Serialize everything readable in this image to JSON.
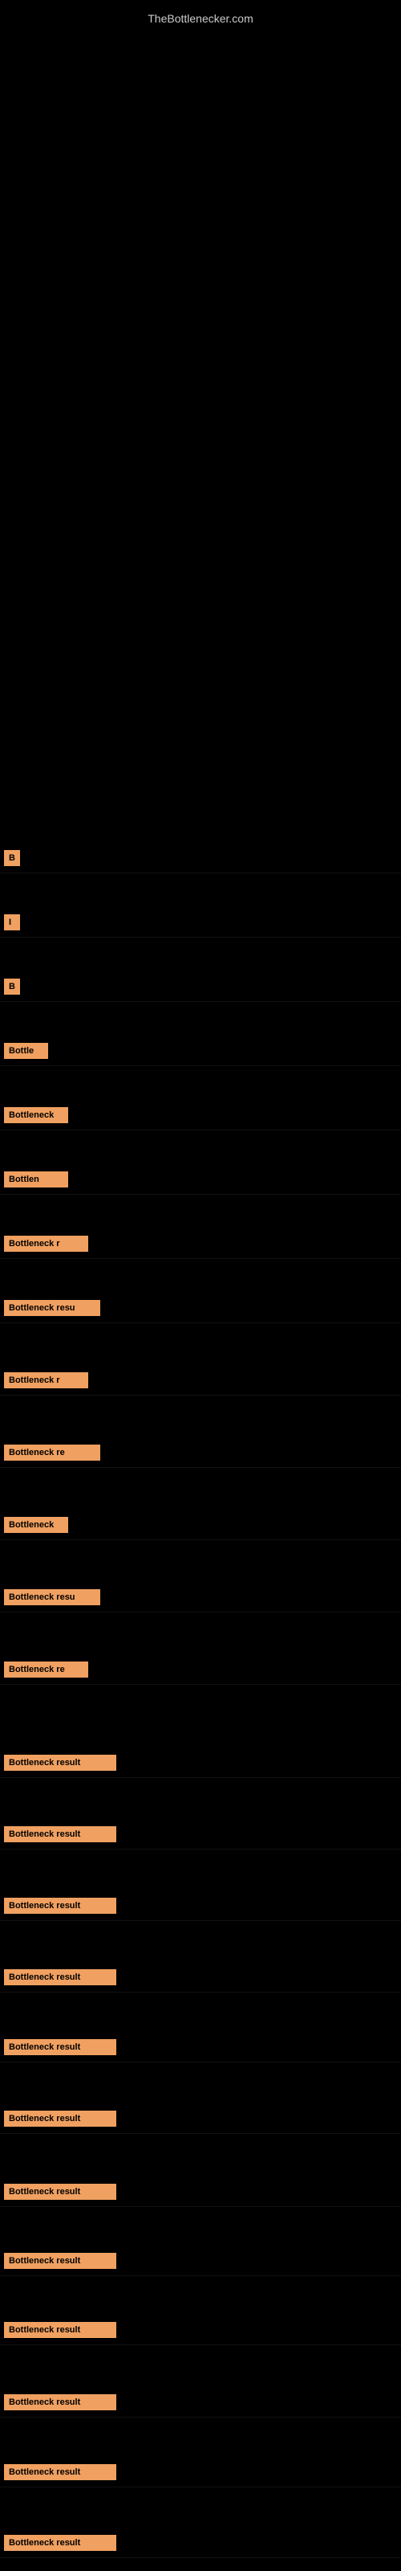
{
  "site": {
    "title": "TheBottlenecker.com"
  },
  "items": [
    {
      "id": 1,
      "label": "B",
      "labelClass": "label-xs",
      "topOffset": 1050
    },
    {
      "id": 2,
      "label": "I",
      "labelClass": "label-xs",
      "topOffset": 1130
    },
    {
      "id": 3,
      "label": "B",
      "labelClass": "label-xs",
      "topOffset": 1210
    },
    {
      "id": 4,
      "label": "Bottle",
      "labelClass": "label-md",
      "topOffset": 1290
    },
    {
      "id": 5,
      "label": "Bottleneck",
      "labelClass": "label-lg",
      "topOffset": 1370
    },
    {
      "id": 6,
      "label": "Bottlen",
      "labelClass": "label-lg",
      "topOffset": 1450
    },
    {
      "id": 7,
      "label": "Bottleneck r",
      "labelClass": "label-xl",
      "topOffset": 1530
    },
    {
      "id": 8,
      "label": "Bottleneck resu",
      "labelClass": "label-xxl",
      "topOffset": 1610
    },
    {
      "id": 9,
      "label": "Bottleneck r",
      "labelClass": "label-xl",
      "topOffset": 1700
    },
    {
      "id": 10,
      "label": "Bottleneck re",
      "labelClass": "label-xxl",
      "topOffset": 1790
    },
    {
      "id": 11,
      "label": "Bottleneck",
      "labelClass": "label-lg",
      "topOffset": 1880
    },
    {
      "id": 12,
      "label": "Bottleneck resu",
      "labelClass": "label-xxl",
      "topOffset": 1970
    },
    {
      "id": 13,
      "label": "Bottleneck re",
      "labelClass": "label-xl",
      "topOffset": 2060
    },
    {
      "id": 14,
      "label": "Bottleneck result",
      "labelClass": "label-full",
      "topOffset": 2176
    },
    {
      "id": 15,
      "label": "Bottleneck result",
      "labelClass": "label-full",
      "topOffset": 2265
    },
    {
      "id": 16,
      "label": "Bottleneck result",
      "labelClass": "label-full",
      "topOffset": 2354
    },
    {
      "id": 17,
      "label": "Bottleneck result",
      "labelClass": "label-full",
      "topOffset": 2443
    },
    {
      "id": 18,
      "label": "Bottleneck result",
      "labelClass": "label-full",
      "topOffset": 2530
    },
    {
      "id": 19,
      "label": "Bottleneck result",
      "labelClass": "label-full",
      "topOffset": 2619
    },
    {
      "id": 20,
      "label": "Bottleneck result",
      "labelClass": "label-full",
      "topOffset": 2710
    },
    {
      "id": 21,
      "label": "Bottleneck result",
      "labelClass": "label-full",
      "topOffset": 2796
    },
    {
      "id": 22,
      "label": "Bottleneck result",
      "labelClass": "label-full",
      "topOffset": 2882
    },
    {
      "id": 23,
      "label": "Bottleneck result",
      "labelClass": "label-full",
      "topOffset": 2972
    },
    {
      "id": 24,
      "label": "Bottleneck result",
      "labelClass": "label-full",
      "topOffset": 3059
    },
    {
      "id": 25,
      "label": "Bottleneck result",
      "labelClass": "label-full",
      "topOffset": 3147
    }
  ]
}
